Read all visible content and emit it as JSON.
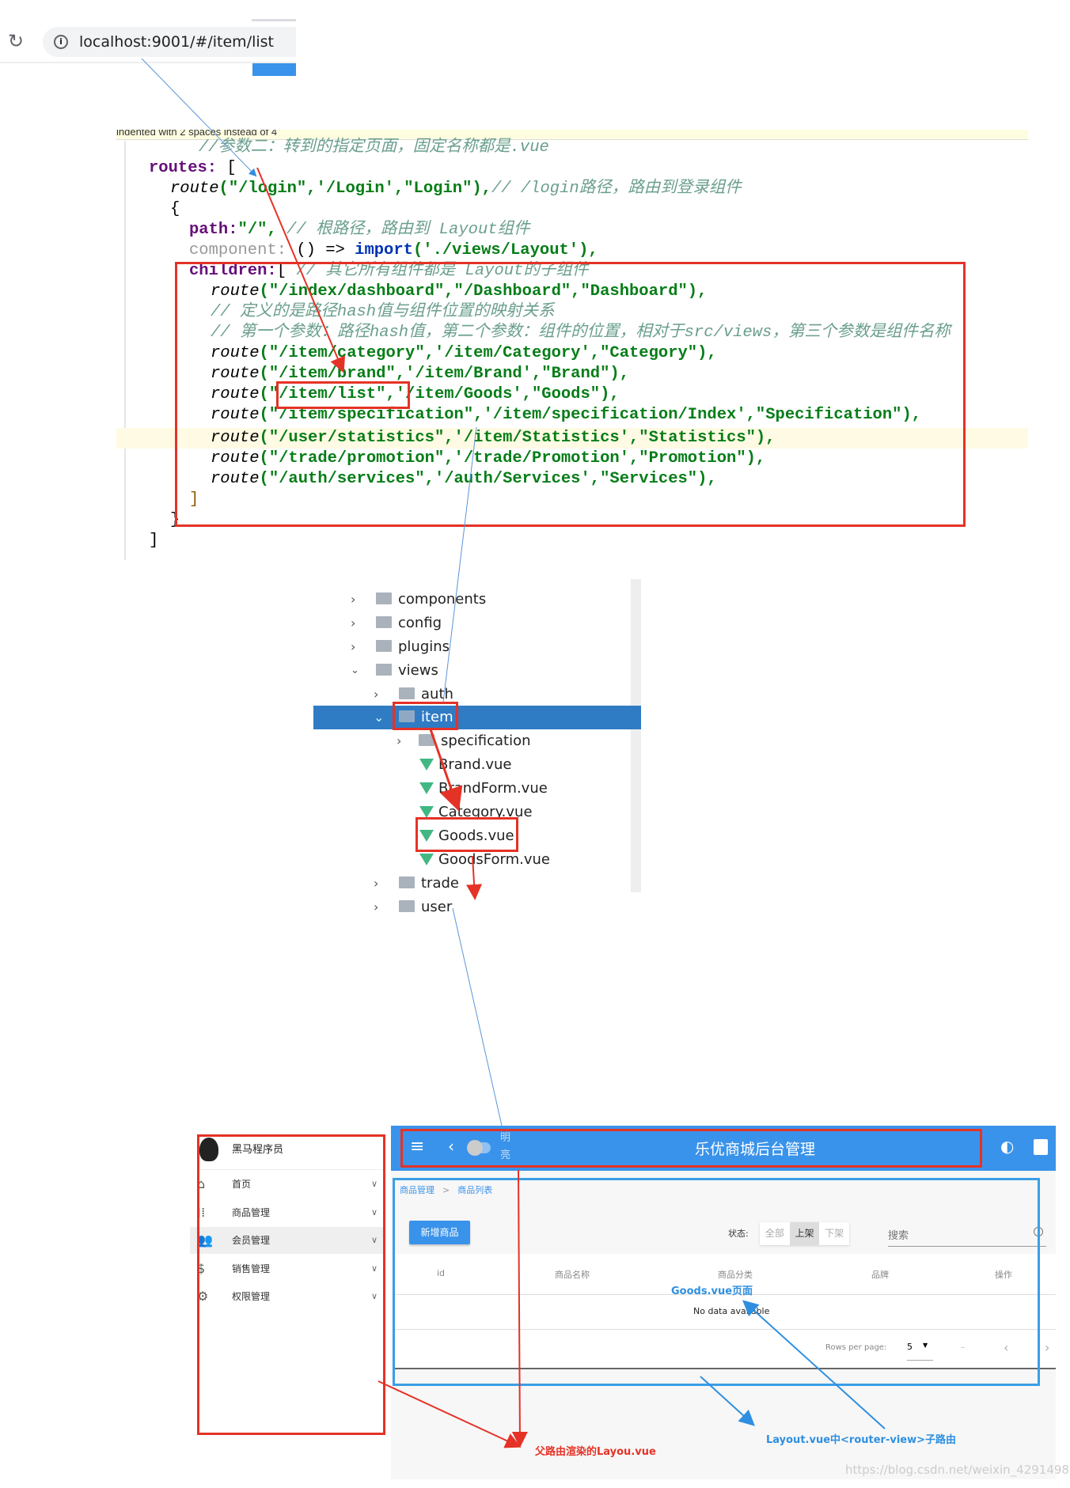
{
  "browser": {
    "url": "localhost:9001/#/item/list",
    "reload_icon": "reload-icon",
    "info_icon": "info-icon"
  },
  "editor": {
    "notice": "indented with 2 spaces instead of 4",
    "lines": {
      "c1": "//参数二：转到的指定页面，固定名称都是.vue",
      "routes": "routes:",
      "routes_br": " [",
      "login_fn": "route",
      "login_args": "(\"/login\",'/Login',\"Login\"),",
      "login_cm": "// /login路径，路由到登录组件",
      "brace": "{",
      "path_k": "path:",
      "path_v": "\"/\",",
      "path_cm": " // 根路径，路由到 Layout组件",
      "comp_k": "component:",
      "comp_mid": " () => ",
      "comp_imp": "import",
      "comp_v": "('./views/Layout'),",
      "children_k": "children:",
      "children_br": "[ ",
      "children_cm": "// 其它所有组件都是 Layout的子组件",
      "r_index": "(\"/index/dashboard\",\"/Dashboard\",\"Dashboard\"),",
      "c2": "// 定义的是路径hash值与组件位置的映射关系",
      "c3": "// 第一个参数：路径hash值，第二个参数：组件的位置，相对于src/views，第三个参数是组件名称",
      "r_category": "(\"/item/category\",'/item/Category',\"Category\"),",
      "r_brand": "(\"/item/brand\",'/item/Brand',\"Brand\"),",
      "r_list": "(\"/item/list\",'/item/Goods',\"Goods\"),",
      "r_spec": "(\"/item/specification\",'/item/specification/Index',\"Specification\"),",
      "r_stat": "(\"/user/statistics\",'/item/Statistics',\"Statistics\"),",
      "r_promo": "(\"/trade/promotion\",'/trade/Promotion',\"Promotion\"),",
      "r_services": "(\"/auth/services\",'/auth/Services',\"Services\"),",
      "close_br": "]",
      "close_brace": "}",
      "close_routes": "]",
      "fn": "route"
    }
  },
  "tree": {
    "items": [
      "components",
      "config",
      "plugins",
      "views",
      "auth",
      "item",
      "specification",
      "Brand.vue",
      "BrandForm.vue",
      "Category.vue",
      "Goods.vue",
      "GoodsForm.vue",
      "trade",
      "user"
    ]
  },
  "app": {
    "user_name": "黑马程序员",
    "sidebar": [
      {
        "label": "首页",
        "icon": "home-icon"
      },
      {
        "label": "商品管理",
        "icon": "apps-icon"
      },
      {
        "label": "会员管理",
        "icon": "people-icon"
      },
      {
        "label": "销售管理",
        "icon": "dollar-icon"
      },
      {
        "label": "权限管理",
        "icon": "gear-icon"
      }
    ],
    "header": {
      "title": "乐优商城后台管理",
      "toggle_label_1": "明",
      "toggle_label_2": "亮"
    },
    "breadcrumb": [
      "商品管理",
      "商品列表"
    ],
    "add_button": "新增商品",
    "status_label": "状态:",
    "status_options": [
      "全部",
      "上架",
      "下架"
    ],
    "status_selected": "上架",
    "search_placeholder": "搜索",
    "columns": [
      "id",
      "商品名称",
      "商品分类",
      "品牌",
      "操作"
    ],
    "empty": "No data available",
    "rows_per_page_label": "Rows per page:",
    "rows_per_page": "5",
    "page_info": "–",
    "primary_color": "#3a93ea"
  },
  "annotations": {
    "goods": "Goods.vue页面",
    "layout": "父路由渲染的Layou.vue",
    "router_view": "Layout.vue中<router-view>子路由",
    "watermark": "https://blog.csdn.net/weixin_42914989"
  }
}
